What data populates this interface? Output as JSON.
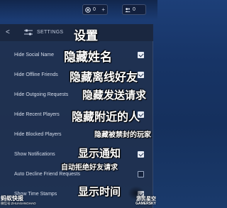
{
  "topbar": {
    "coins_value": "0",
    "friends_value": "0",
    "plus": "+"
  },
  "settings": {
    "back": "<",
    "title": "SETTINGS",
    "title_cn": "设置"
  },
  "rows": [
    {
      "label": "Hide Social Name",
      "cn": "隐藏姓名",
      "checked": true
    },
    {
      "label": "Hide Offline Friends",
      "cn": "隐藏离线好友",
      "checked": true
    },
    {
      "label": "Hide Outgoing Requests",
      "cn": "隐藏发送请求",
      "checked": true
    },
    {
      "label": "Hide Recent Players",
      "cn": "隐藏附近的人",
      "checked": true
    },
    {
      "label": "Hide Blocked Players",
      "cn": "隐藏被禁封的玩家",
      "checked": true
    },
    {
      "label": "Show Notifications",
      "cn": "显示通知",
      "checked": true
    },
    {
      "label": "Auto Decline Friend Requests",
      "cn": "自动拒绝好友请求",
      "checked": false
    },
    {
      "label": "Show Time Stamps",
      "cn": "显示时间",
      "checked": true
    }
  ],
  "watermark": {
    "left_main": "蚂蚁快报",
    "left_small": "微信号:ZHUASANGHAO",
    "right_main": "游民星空",
    "right_small": "GAMERSKY"
  },
  "colors": {
    "panel": "#21314e",
    "check_on": "#e7ecf5",
    "text": "#d7deeb"
  }
}
